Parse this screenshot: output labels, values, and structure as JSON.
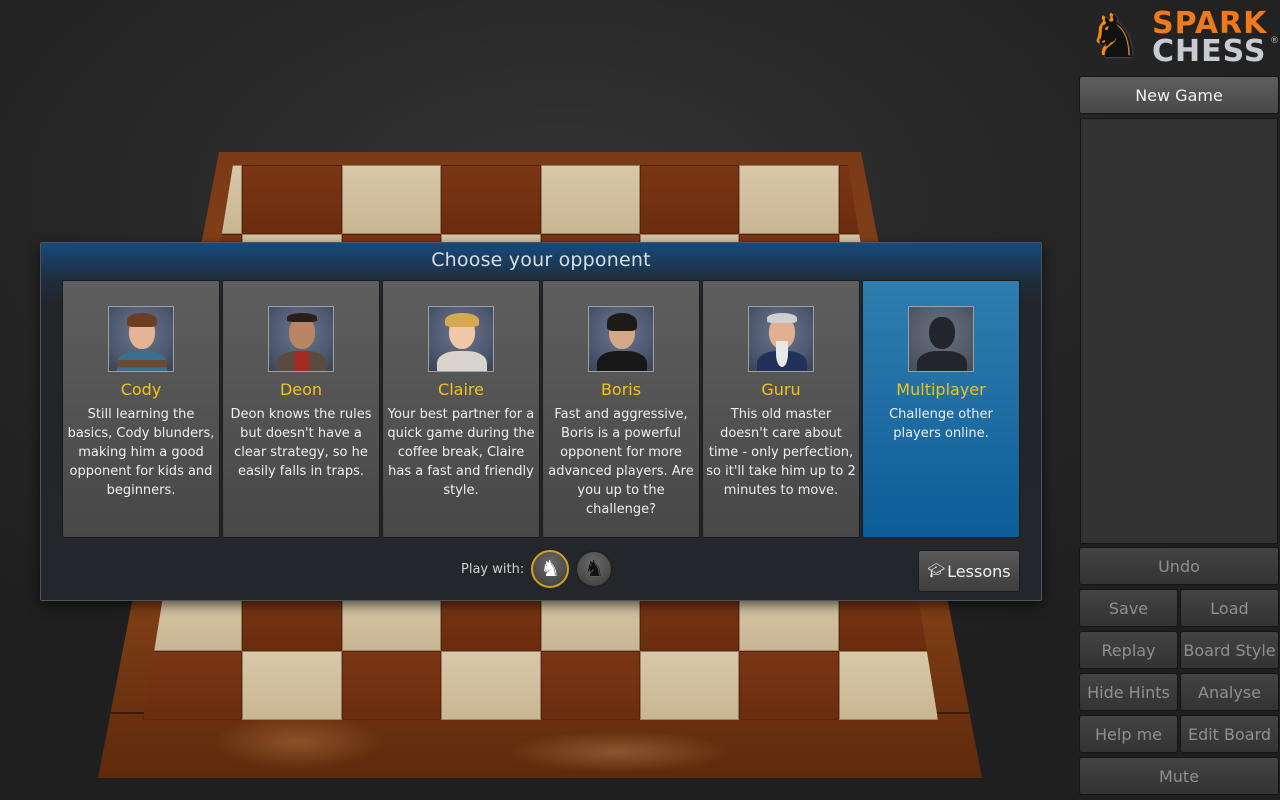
{
  "app": {
    "brand_top": "SPARK",
    "brand_bottom": "CHESS",
    "registered_mark": "®"
  },
  "board": {
    "rows": 8,
    "cols": 8
  },
  "dialog": {
    "title": "Choose your opponent",
    "opponents": [
      {
        "name": "Cody",
        "description": "Still learning the basics, Cody blunders, making him a good opponent for kids and beginners.",
        "selected": false
      },
      {
        "name": "Deon",
        "description": "Deon knows the rules but doesn't have a clear strategy, so he easily falls in traps.",
        "selected": false
      },
      {
        "name": "Claire",
        "description": "Your best partner for a quick game during the coffee break, Claire has a fast and friendly style.",
        "selected": false
      },
      {
        "name": "Boris",
        "description": "Fast and aggressive, Boris is a powerful opponent for more advanced players. Are you up to the challenge?",
        "selected": false
      },
      {
        "name": "Guru",
        "description": "This old master doesn't care about time - only perfection, so it'll take him up to 2 minutes to move.",
        "selected": false
      },
      {
        "name": "Multiplayer",
        "description": "Challenge other players online.",
        "selected": true
      }
    ],
    "play_with_label": "Play with:",
    "sides": [
      {
        "name": "white",
        "glyph": "♞",
        "active": true
      },
      {
        "name": "black",
        "glyph": "♞",
        "active": false
      }
    ],
    "lessons_label": "Lessons",
    "lessons_icon": "graduation-cap-icon"
  },
  "panel": {
    "new_game": "New Game",
    "undo": "Undo",
    "save": "Save",
    "load": "Load",
    "replay": "Replay",
    "board_style": "Board Style",
    "hide_hints": "Hide Hints",
    "analyse": "Analyse",
    "help_me": "Help me",
    "edit_board": "Edit Board",
    "mute": "Mute"
  },
  "colors": {
    "accent_name": "#f2c318",
    "selected_card": "#1f6da3",
    "active_side_ring": "#d4a21a",
    "brand_orange": "#f07a1a"
  }
}
